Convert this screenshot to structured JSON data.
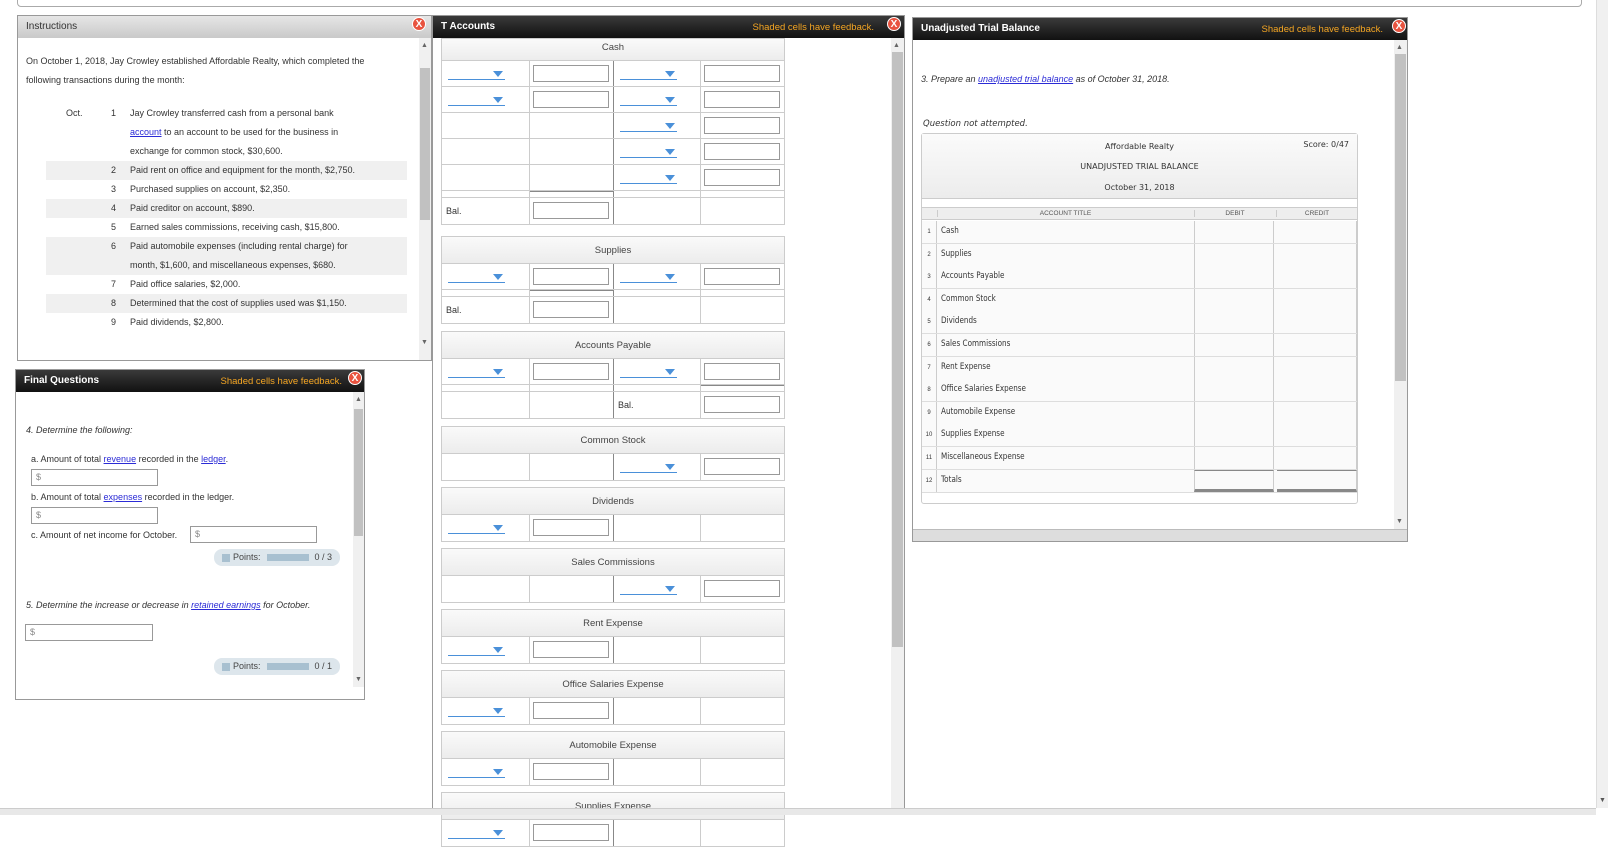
{
  "instructions": {
    "title": "Instructions",
    "intro_line1": "On October 1, 2018, Jay Crowley established Affordable Realty, which completed the",
    "intro_line2": "following transactions during the month:",
    "month": "Oct.",
    "t1_num": "1",
    "t1_a": "Jay Crowley transferred cash from a personal bank",
    "t1_link": "account",
    "t1_b": " to an account to be used for the business in",
    "t1_c": "exchange for common stock, $30,600.",
    "items": [
      {
        "num": "2",
        "text": "Paid rent on office and equipment for the month, $2,750."
      },
      {
        "num": "3",
        "text": "Purchased supplies on account, $2,350."
      },
      {
        "num": "4",
        "text": "Paid creditor on account, $890."
      },
      {
        "num": "5",
        "text": "Earned sales commissions, receiving cash, $15,800."
      },
      {
        "num": "6",
        "text": "Paid automobile expenses (including rental charge) for",
        "text2": "month, $1,600, and miscellaneous expenses, $680."
      },
      {
        "num": "7",
        "text": "Paid office salaries, $2,000."
      },
      {
        "num": "8",
        "text": "Determined that the cost of supplies used was $1,150."
      },
      {
        "num": "9",
        "text": "Paid dividends, $2,800."
      }
    ]
  },
  "close_label": "X",
  "feedback_note": "Shaded cells have feedback.",
  "final_questions": {
    "title": "Final Questions",
    "q4": "4. Determine the following:",
    "a_pre": "a. Amount of total ",
    "a_link1": "revenue",
    "a_mid": " recorded in the ",
    "a_link2": "ledger",
    "a_post": ".",
    "b_pre": "b. Amount of total ",
    "b_link": "expenses",
    "b_post": " recorded in the ledger.",
    "c": "c. Amount of net income for October.",
    "currency": "$",
    "points_label": "Points:",
    "points1": "0 / 3",
    "points1_fraction": 0,
    "q5_pre": "5. Determine the increase or decrease in ",
    "q5_link": "retained earnings",
    "q5_post": " for October.",
    "points2": "0 / 1",
    "points2_fraction": 0
  },
  "t_accounts": {
    "title": "T Accounts",
    "bal_label": "Bal.",
    "accounts": [
      "Cash",
      "Supplies",
      "Accounts Payable",
      "Common Stock",
      "Dividends",
      "Sales Commissions",
      "Rent Expense",
      "Office Salaries Expense",
      "Automobile Expense",
      "Supplies Expense"
    ]
  },
  "trial_balance": {
    "title": "Unadjusted Trial Balance",
    "prompt_pre": "3. Prepare an ",
    "prompt_link": "unadjusted trial balance",
    "prompt_post": " as of October 31, 2018.",
    "status": "Question not attempted.",
    "company": "Affordable Realty",
    "heading": "UNADJUSTED TRIAL BALANCE",
    "date": "October 31, 2018",
    "score": "Score: 0/47",
    "col_title": "ACCOUNT TITLE",
    "col_debit": "DEBIT",
    "col_credit": "CREDIT",
    "rows": [
      {
        "num": "1",
        "title": "Cash"
      },
      {
        "num": "2",
        "title": "Supplies"
      },
      {
        "num": "3",
        "title": "Accounts Payable"
      },
      {
        "num": "4",
        "title": "Common Stock"
      },
      {
        "num": "5",
        "title": "Dividends"
      },
      {
        "num": "6",
        "title": "Sales Commissions"
      },
      {
        "num": "7",
        "title": "Rent Expense"
      },
      {
        "num": "8",
        "title": "Office Salaries Expense"
      },
      {
        "num": "9",
        "title": "Automobile Expense"
      },
      {
        "num": "10",
        "title": "Supplies Expense"
      },
      {
        "num": "11",
        "title": "Miscellaneous Expense"
      },
      {
        "num": "12",
        "title": "Totals"
      }
    ]
  }
}
